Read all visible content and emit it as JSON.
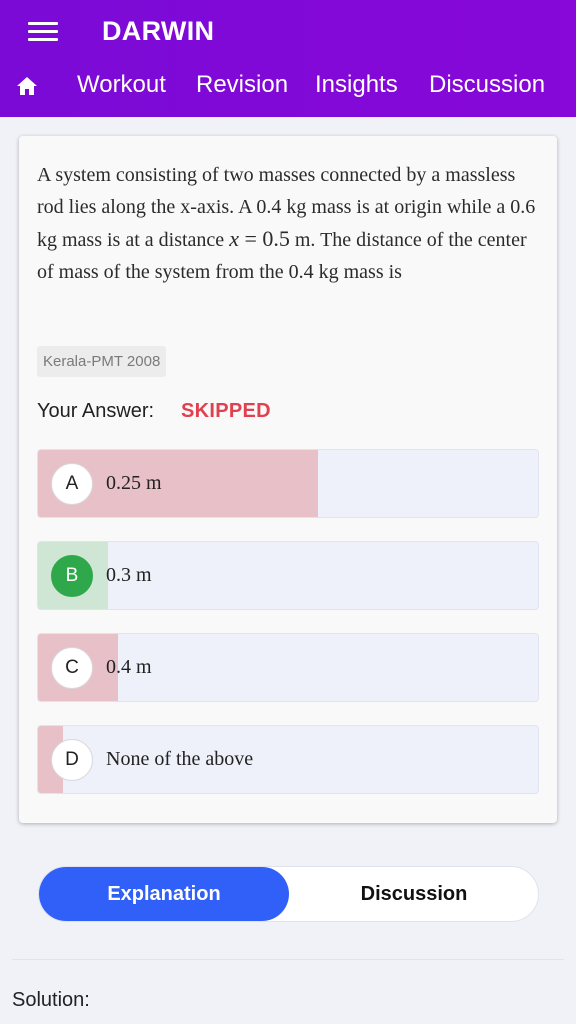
{
  "app": {
    "title": "DARWIN"
  },
  "nav": {
    "items": [
      {
        "label": "Workout"
      },
      {
        "label": "Revision"
      },
      {
        "label": "Insights"
      },
      {
        "label": "Discussion"
      }
    ]
  },
  "question": {
    "text_before": "A system consisting of two masses connected by a massless rod lies along the x-axis. A 0.4 kg mass is at origin while a 0.6 kg mass is at a distance ",
    "math_var": "x",
    "math_eq": " = ",
    "math_val": "0.5",
    "text_after": " m. The distance of the center of mass of the system from the 0.4 kg mass is",
    "source_tag": "Kerala-PMT 2008"
  },
  "answer": {
    "label": "Your Answer:",
    "status": "SKIPPED"
  },
  "options": [
    {
      "letter": "A",
      "text": "0.25 m",
      "response_fraction": 0.56,
      "correct": false
    },
    {
      "letter": "B",
      "text": "0.3 m",
      "response_fraction": 0.14,
      "correct": true
    },
    {
      "letter": "C",
      "text": "0.4 m",
      "response_fraction": 0.16,
      "correct": false
    },
    {
      "letter": "D",
      "text": "None of the above",
      "response_fraction": 0.05,
      "correct": false
    }
  ],
  "tabs": {
    "explanation": "Explanation",
    "discussion": "Discussion"
  },
  "solution": {
    "label": "Solution:"
  },
  "colors": {
    "header": "#8208d7",
    "skipped": "#e0404f",
    "correct": "#2ea84a",
    "active_tab": "#3060f7"
  }
}
